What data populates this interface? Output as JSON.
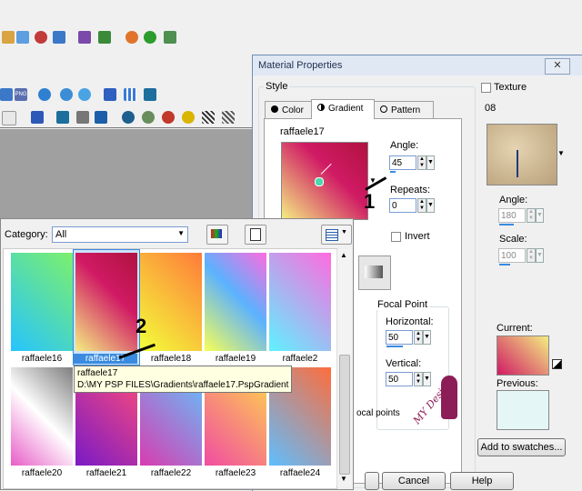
{
  "toolbars": {
    "row1_icon_names": [
      "select-icon",
      "paint-icon",
      "eye-icon",
      "shape-icon",
      "portrait-icon",
      "landscape-icon",
      "globe-icon",
      "sun-icon",
      "picture-icon"
    ],
    "row2_icon_names": [
      "layers-icon",
      "png-icon",
      "globe-icon",
      "grid-icon",
      "ring-icon",
      "selection-icon",
      "dots-icon",
      "square-icon"
    ],
    "row3_icon_names": [
      "frame-icon",
      "blue-frame-icon",
      "film-icon",
      "shape-icon",
      "target-icon",
      "bullseye-icon",
      "rose-icon",
      "ring-icon",
      "pattern-icon",
      "zigzag-icon"
    ],
    "png_label": "PNG"
  },
  "dialog": {
    "title": "Material Properties",
    "close_label": "✕",
    "style_label": "Style",
    "tabs": [
      {
        "label": "Color",
        "active": false
      },
      {
        "label": "Gradient",
        "active": true
      },
      {
        "label": "Pattern",
        "active": false
      }
    ],
    "gradient_name": "raffaele17",
    "angle_label": "Angle:",
    "angle_value": "45",
    "repeats_label": "Repeats:",
    "repeats_value": "0",
    "invert_label": "Invert",
    "focal_point_label": "Focal Point",
    "horizontal_label": "Horizontal:",
    "horizontal_value": "50",
    "vertical_label": "Vertical:",
    "vertical_value": "50",
    "focal_partial_text": "ocal points",
    "texture_label": "Texture",
    "texture_name": "08",
    "texture_angle_label": "Angle:",
    "texture_angle_value": "180",
    "scale_label": "Scale:",
    "scale_value": "100",
    "current_label": "Current:",
    "previous_label": "Previous:",
    "add_swatches_label": "Add to swatches...",
    "cancel_label": "Cancel",
    "help_label": "Help",
    "annotation_1": "1",
    "watermark_text": "MY Designs"
  },
  "popup": {
    "category_label": "Category:",
    "category_value": "All",
    "thumbnails": [
      {
        "label": "raffaele16",
        "colors": [
          "#7df06b",
          "#26c4ff"
        ]
      },
      {
        "label": "raffaele17",
        "colors": [
          "#f4ee82",
          "#d01a64"
        ]
      },
      {
        "label": "raffaele18",
        "colors": [
          "#ff7b3a",
          "#f3ff3a"
        ]
      },
      {
        "label": "raffaele19",
        "colors": [
          "#5bb2ff",
          "#f7ff56"
        ]
      },
      {
        "label": "raffaele2",
        "colors": [
          "#ff6bdf",
          "#5ff2ff"
        ]
      },
      {
        "label": "raffaele20",
        "colors": [
          "#7e7e7e",
          "#e85dc8"
        ]
      },
      {
        "label": "raffaele21",
        "colors": [
          "#ff4c7a",
          "#7a1ac6"
        ]
      },
      {
        "label": "raffaele22",
        "colors": [
          "#5fc7ff",
          "#d83cb0"
        ]
      },
      {
        "label": "raffaele23",
        "colors": [
          "#ffd84a",
          "#f14ca2"
        ]
      },
      {
        "label": "raffaele24",
        "colors": [
          "#ff6d3c",
          "#5ebeff"
        ]
      }
    ],
    "tooltip_line1": "raffaele17",
    "tooltip_line2": "D:\\MY PSP FILES\\Gradients\\raffaele17.PspGradient",
    "annotation_2": "2"
  }
}
